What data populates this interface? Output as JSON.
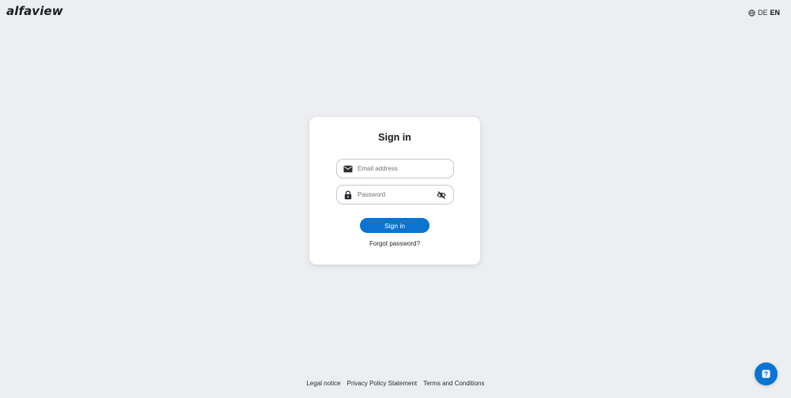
{
  "header": {
    "logo": "alfaview",
    "languages": [
      {
        "code": "DE",
        "active": false
      },
      {
        "code": "EN",
        "active": true
      }
    ]
  },
  "login": {
    "title": "Sign in",
    "email_placeholder": "Email address",
    "password_placeholder": "Password",
    "submit_label": "Sign in",
    "forgot_label": "Forgot password?"
  },
  "footer": {
    "links": [
      "Legal notice",
      "Privacy Policy Statement",
      "Terms and Conditions"
    ]
  },
  "icons": {
    "language": "globe-icon",
    "email": "envelope-icon",
    "password": "lock-icon",
    "toggle_password": "eye-slash-icon",
    "help": "help-icon"
  },
  "colors": {
    "background": "#eceef2",
    "accent": "#0a74d0",
    "card": "#ffffff"
  }
}
